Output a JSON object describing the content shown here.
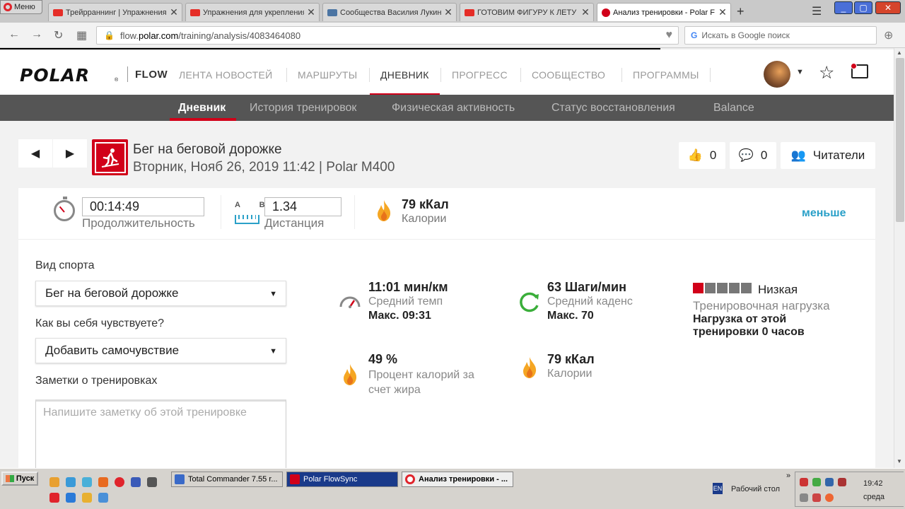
{
  "browser": {
    "menu_label": "Меню",
    "tabs": [
      {
        "title": "Трейрраннинг | Упражнения",
        "icon": "youtube"
      },
      {
        "title": "Упражнения для укрепления",
        "icon": "youtube"
      },
      {
        "title": "Сообщества Василия Лукин",
        "icon": "vk"
      },
      {
        "title": "ГОТОВИМ ФИГУРУ К ЛЕТУ",
        "icon": "youtube"
      },
      {
        "title": "Анализ тренировки - Polar F",
        "icon": "polar"
      }
    ],
    "url_domain": "flow.polar.com",
    "url_path": "/training/analysis/4083464080",
    "url_prefix": "flow.",
    "url_host": "polar.com",
    "search_placeholder": "Искать в Google поиск"
  },
  "site": {
    "logo": "POLAR",
    "logo_reg": "®",
    "product": "FLOW",
    "nav": [
      "ЛЕНТА НОВОСТЕЙ",
      "МАРШРУТЫ",
      "ДНЕВНИК",
      "ПРОГРЕСС",
      "СООБЩЕСТВО",
      "ПРОГРАММЫ"
    ],
    "nav_active": "ДНЕВНИК",
    "subnav": [
      "Дневник",
      "История тренировок",
      "Физическая активность",
      "Статус восстановления",
      "Balance"
    ],
    "accent": "#d10019",
    "link_color": "#2aa0c8"
  },
  "workout": {
    "title": "Бег на беговой дорожке",
    "subtitle": "Вторник, Нояб 26, 2019 11:42 | Polar M400",
    "likes": "0",
    "comments": "0",
    "readers_label": "Читатели"
  },
  "summary": {
    "duration_value": "00:14:49",
    "duration_label": "Продолжительность",
    "ab_label": "A B",
    "distance_value": "1.34",
    "distance_label": "Дистанция",
    "calories_value": "79 кКал",
    "calories_label": "Калории",
    "less_label": "меньше"
  },
  "form": {
    "sport_label": "Вид спорта",
    "sport_value": "Бег на беговой дорожке",
    "feeling_label": "Как вы себя чувствуете?",
    "feeling_value": "Добавить самочувствие",
    "notes_label": "Заметки о тренировках",
    "notes_placeholder": "Напишите заметку об этой тренировке"
  },
  "metrics": {
    "pace_value": "11:01 мин/км",
    "pace_label": "Средний темп",
    "pace_max": "Макс. 09:31",
    "cadence_value": "63 Шаги/мин",
    "cadence_label": "Средний каденс",
    "cadence_max": "Макс. 70",
    "load_level": "Низкая",
    "load_level_index": 1,
    "load_level_total": 5,
    "load_label": "Тренировочная нагрузка",
    "load_note": "Нагрузка от этой тренировки 0 часов",
    "fat_value": "49 %",
    "fat_label": "Процент калорий за счет жира",
    "cal_value": "79 кКал",
    "cal_label": "Калории"
  },
  "taskbar": {
    "start_label": "Пуск",
    "windows": [
      {
        "title": "Total Commander 7.55 r...",
        "active": false
      },
      {
        "title": "Polar FlowSync",
        "active": false
      },
      {
        "title": "Анализ тренировки - ...",
        "active": true
      }
    ],
    "lang": "EN",
    "desktop_label": "Рабочий стол",
    "time": "19:42",
    "day": "среда"
  }
}
